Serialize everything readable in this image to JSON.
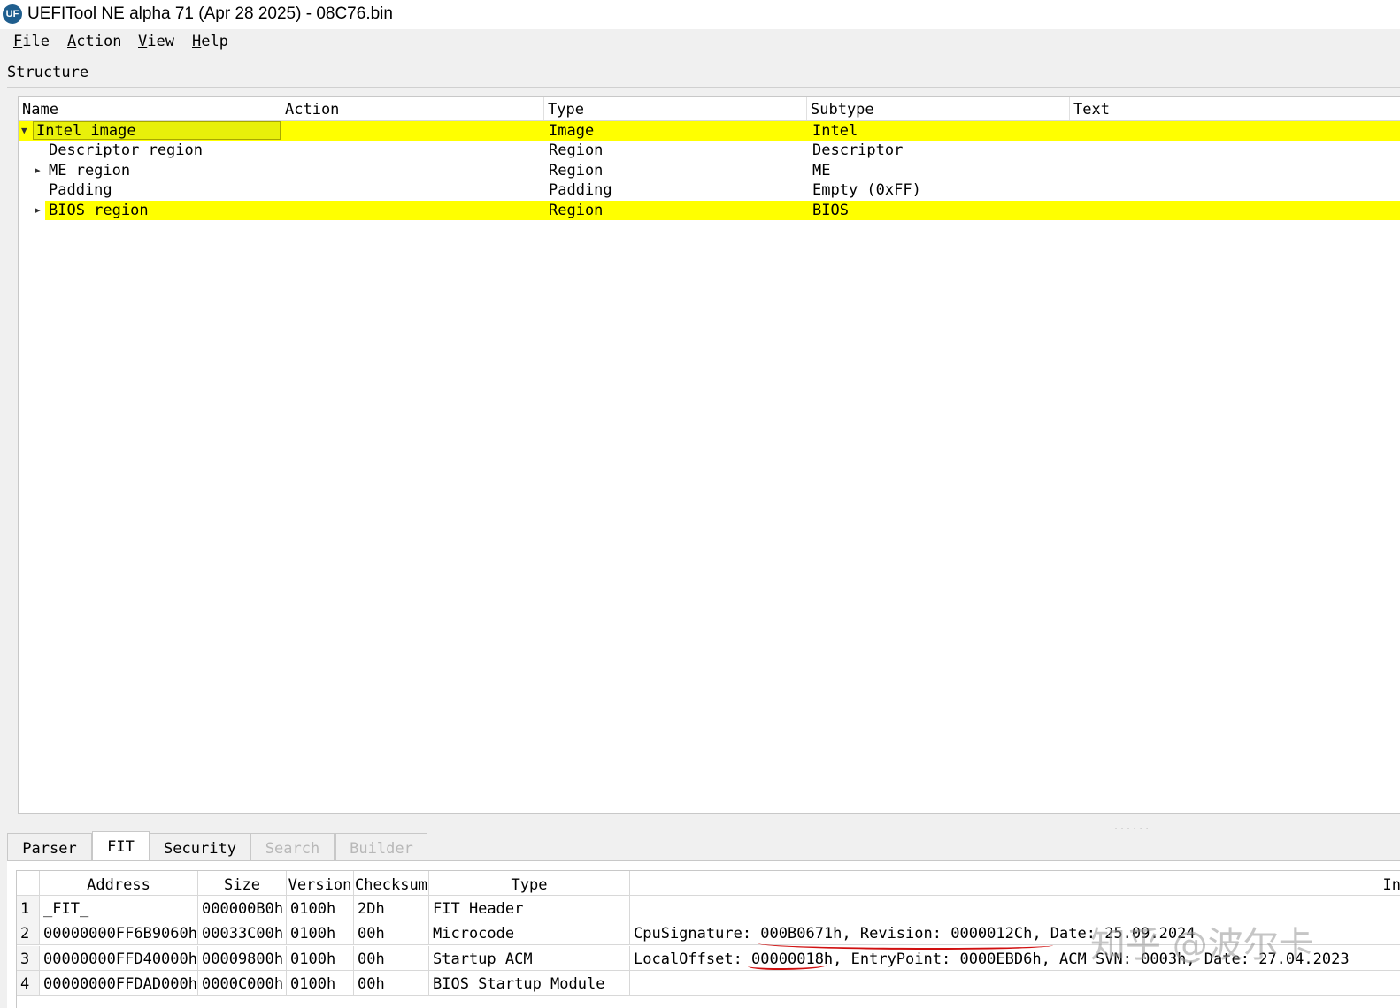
{
  "window": {
    "title": "UEFITool NE alpha 71 (Apr 28 2025) - 08C76.bin",
    "icon_text": "UF"
  },
  "menu": [
    {
      "accel": "F",
      "rest": "ile"
    },
    {
      "accel": "A",
      "rest": "ction"
    },
    {
      "accel": "V",
      "rest": "iew"
    },
    {
      "accel": "H",
      "rest": "elp"
    }
  ],
  "structure": {
    "label": "Structure",
    "columns": [
      "Name",
      "Action",
      "Type",
      "Subtype",
      "Text"
    ],
    "rows": [
      {
        "expander": "▼",
        "name": "Intel image",
        "action": "",
        "type": "Image",
        "subtype": "Intel",
        "text": "",
        "highlight": true,
        "selected": true
      },
      {
        "expander": "",
        "name": "Descriptor region",
        "action": "",
        "type": "Region",
        "subtype": "Descriptor",
        "text": "",
        "highlight": false
      },
      {
        "expander": "▶",
        "name": "ME region",
        "action": "",
        "type": "Region",
        "subtype": "ME",
        "text": "",
        "highlight": false
      },
      {
        "expander": "",
        "name": "Padding",
        "action": "",
        "type": "Padding",
        "subtype": "Empty (0xFF)",
        "text": "",
        "highlight": false
      },
      {
        "expander": "▶",
        "name": "BIOS region",
        "action": "",
        "type": "Region",
        "subtype": "BIOS",
        "text": "",
        "highlight": true
      }
    ]
  },
  "tabs": [
    {
      "label": "Parser",
      "state": "normal"
    },
    {
      "label": "FIT",
      "state": "active"
    },
    {
      "label": "Security",
      "state": "normal"
    },
    {
      "label": "Search",
      "state": "disabled"
    },
    {
      "label": "Builder",
      "state": "disabled"
    }
  ],
  "fit": {
    "columns": [
      "",
      "Address",
      "Size",
      "Version",
      "Checksum",
      "Type",
      "In"
    ],
    "rows": [
      {
        "num": "1",
        "address": "_FIT_",
        "size": "000000B0h",
        "version": "0100h",
        "checksum": "2Dh",
        "type": "FIT Header",
        "info": ""
      },
      {
        "num": "2",
        "address": "00000000FF6B9060h",
        "size": "00033C00h",
        "version": "0100h",
        "checksum": "00h",
        "type": "Microcode",
        "info": "CpuSignature: 000B0671h, Revision: 0000012Ch, Date: 25.09.2024"
      },
      {
        "num": "3",
        "address": "00000000FFD40000h",
        "size": "00009800h",
        "version": "0100h",
        "checksum": "00h",
        "type": "Startup ACM",
        "info": "LocalOffset: 00000018h, EntryPoint: 0000EBD6h, ACM SVN: 0003h, Date: 27.04.2023"
      },
      {
        "num": "4",
        "address": "00000000FFDAD000h",
        "size": "0000C000h",
        "version": "0100h",
        "checksum": "00h",
        "type": "BIOS Startup Module",
        "info": ""
      }
    ]
  },
  "watermark": "知乎 @波尔卡",
  "colors": {
    "highlight": "#ffff00",
    "annotation": "#d01010"
  }
}
